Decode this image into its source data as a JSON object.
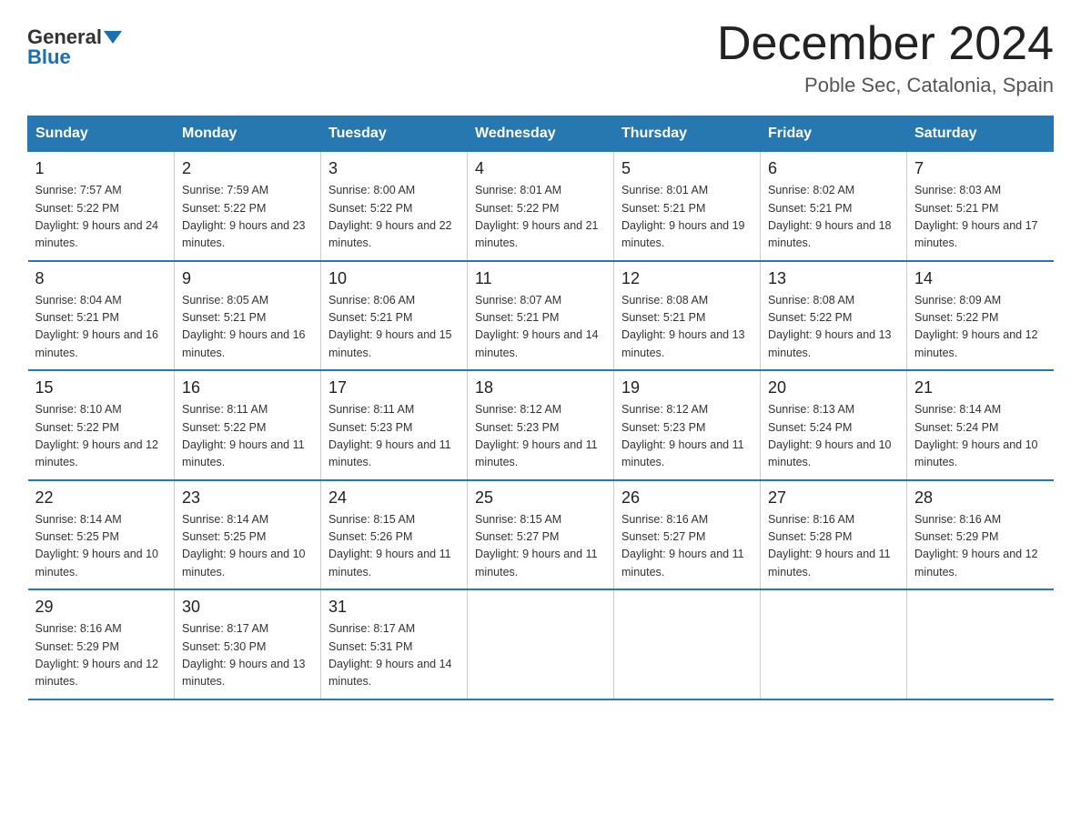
{
  "header": {
    "logo_general": "General",
    "logo_blue": "Blue",
    "month_title": "December 2024",
    "location": "Poble Sec, Catalonia, Spain"
  },
  "days_of_week": [
    "Sunday",
    "Monday",
    "Tuesday",
    "Wednesday",
    "Thursday",
    "Friday",
    "Saturday"
  ],
  "weeks": [
    [
      {
        "day": "1",
        "sunrise": "7:57 AM",
        "sunset": "5:22 PM",
        "daylight": "9 hours and 24 minutes."
      },
      {
        "day": "2",
        "sunrise": "7:59 AM",
        "sunset": "5:22 PM",
        "daylight": "9 hours and 23 minutes."
      },
      {
        "day": "3",
        "sunrise": "8:00 AM",
        "sunset": "5:22 PM",
        "daylight": "9 hours and 22 minutes."
      },
      {
        "day": "4",
        "sunrise": "8:01 AM",
        "sunset": "5:22 PM",
        "daylight": "9 hours and 21 minutes."
      },
      {
        "day": "5",
        "sunrise": "8:01 AM",
        "sunset": "5:21 PM",
        "daylight": "9 hours and 19 minutes."
      },
      {
        "day": "6",
        "sunrise": "8:02 AM",
        "sunset": "5:21 PM",
        "daylight": "9 hours and 18 minutes."
      },
      {
        "day": "7",
        "sunrise": "8:03 AM",
        "sunset": "5:21 PM",
        "daylight": "9 hours and 17 minutes."
      }
    ],
    [
      {
        "day": "8",
        "sunrise": "8:04 AM",
        "sunset": "5:21 PM",
        "daylight": "9 hours and 16 minutes."
      },
      {
        "day": "9",
        "sunrise": "8:05 AM",
        "sunset": "5:21 PM",
        "daylight": "9 hours and 16 minutes."
      },
      {
        "day": "10",
        "sunrise": "8:06 AM",
        "sunset": "5:21 PM",
        "daylight": "9 hours and 15 minutes."
      },
      {
        "day": "11",
        "sunrise": "8:07 AM",
        "sunset": "5:21 PM",
        "daylight": "9 hours and 14 minutes."
      },
      {
        "day": "12",
        "sunrise": "8:08 AM",
        "sunset": "5:21 PM",
        "daylight": "9 hours and 13 minutes."
      },
      {
        "day": "13",
        "sunrise": "8:08 AM",
        "sunset": "5:22 PM",
        "daylight": "9 hours and 13 minutes."
      },
      {
        "day": "14",
        "sunrise": "8:09 AM",
        "sunset": "5:22 PM",
        "daylight": "9 hours and 12 minutes."
      }
    ],
    [
      {
        "day": "15",
        "sunrise": "8:10 AM",
        "sunset": "5:22 PM",
        "daylight": "9 hours and 12 minutes."
      },
      {
        "day": "16",
        "sunrise": "8:11 AM",
        "sunset": "5:22 PM",
        "daylight": "9 hours and 11 minutes."
      },
      {
        "day": "17",
        "sunrise": "8:11 AM",
        "sunset": "5:23 PM",
        "daylight": "9 hours and 11 minutes."
      },
      {
        "day": "18",
        "sunrise": "8:12 AM",
        "sunset": "5:23 PM",
        "daylight": "9 hours and 11 minutes."
      },
      {
        "day": "19",
        "sunrise": "8:12 AM",
        "sunset": "5:23 PM",
        "daylight": "9 hours and 11 minutes."
      },
      {
        "day": "20",
        "sunrise": "8:13 AM",
        "sunset": "5:24 PM",
        "daylight": "9 hours and 10 minutes."
      },
      {
        "day": "21",
        "sunrise": "8:14 AM",
        "sunset": "5:24 PM",
        "daylight": "9 hours and 10 minutes."
      }
    ],
    [
      {
        "day": "22",
        "sunrise": "8:14 AM",
        "sunset": "5:25 PM",
        "daylight": "9 hours and 10 minutes."
      },
      {
        "day": "23",
        "sunrise": "8:14 AM",
        "sunset": "5:25 PM",
        "daylight": "9 hours and 10 minutes."
      },
      {
        "day": "24",
        "sunrise": "8:15 AM",
        "sunset": "5:26 PM",
        "daylight": "9 hours and 11 minutes."
      },
      {
        "day": "25",
        "sunrise": "8:15 AM",
        "sunset": "5:27 PM",
        "daylight": "9 hours and 11 minutes."
      },
      {
        "day": "26",
        "sunrise": "8:16 AM",
        "sunset": "5:27 PM",
        "daylight": "9 hours and 11 minutes."
      },
      {
        "day": "27",
        "sunrise": "8:16 AM",
        "sunset": "5:28 PM",
        "daylight": "9 hours and 11 minutes."
      },
      {
        "day": "28",
        "sunrise": "8:16 AM",
        "sunset": "5:29 PM",
        "daylight": "9 hours and 12 minutes."
      }
    ],
    [
      {
        "day": "29",
        "sunrise": "8:16 AM",
        "sunset": "5:29 PM",
        "daylight": "9 hours and 12 minutes."
      },
      {
        "day": "30",
        "sunrise": "8:17 AM",
        "sunset": "5:30 PM",
        "daylight": "9 hours and 13 minutes."
      },
      {
        "day": "31",
        "sunrise": "8:17 AM",
        "sunset": "5:31 PM",
        "daylight": "9 hours and 14 minutes."
      },
      null,
      null,
      null,
      null
    ]
  ]
}
